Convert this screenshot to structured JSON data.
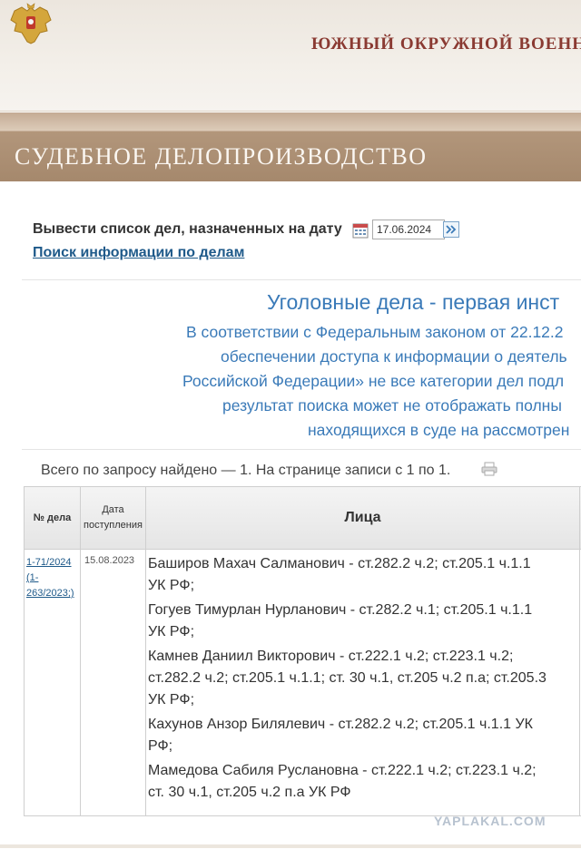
{
  "header": {
    "court_name": "Южный окружной военн"
  },
  "section": {
    "title": "СУДЕБНОЕ ДЕЛОПРОИЗВОДСТВО"
  },
  "date_filter": {
    "label": "Вывести список дел, назначенных на дату",
    "date_value": "17.06.2024"
  },
  "search_link": "Поиск информации по делам",
  "case_heading": "Уголовные дела - первая инст",
  "notice_lines": [
    "В соответствии с Федеральным законом от 22.12.2",
    "обеспечении доступа к информации о деятель",
    "Российской Федерации» не все категории дел подл",
    "результат поиска может не отображать полны",
    "находящихся в суде на рассмотрен"
  ],
  "found_text": "Всего по запросу найдено — 1. На странице записи с 1 по 1.",
  "table": {
    "headers": {
      "number": "№ дела",
      "date": [
        "Дата",
        "поступления"
      ],
      "persons": "Лица"
    },
    "row": {
      "case_number": [
        "1-71/2024",
        "(1-",
        "263/2023;)"
      ],
      "date": "15.08.2023",
      "persons_lines": [
        "Баширов Махач Салманович - ст.282.2 ч.2; ст.205.1 ч.1.1",
        "УК РФ;",
        "Гогуев Тимурлан Нурланович - ст.282.2 ч.1; ст.205.1 ч.1.1",
        "УК РФ;",
        "Камнев Даниил Викторович - ст.222.1 ч.2; ст.223.1 ч.2;",
        "ст.282.2 ч.2; ст.205.1 ч.1.1; ст. 30 ч.1, ст.205 ч.2 п.а; ст.205.3",
        "УК РФ;",
        "Кахунов Анзор Билялевич - ст.282.2 ч.2; ст.205.1 ч.1.1 УК",
        "РФ;",
        "Мамедова Сабиля Руслановна - ст.222.1 ч.2; ст.223.1 ч.2;",
        "ст. 30 ч.1, ст.205 ч.2 п.а УК РФ"
      ]
    }
  },
  "watermark": "YAPLAKAL.COM",
  "colors": {
    "accent": "#3a7ab8",
    "link": "#1f5a8a",
    "section_bar": "#a5886c",
    "court_name": "#8a3a32"
  }
}
